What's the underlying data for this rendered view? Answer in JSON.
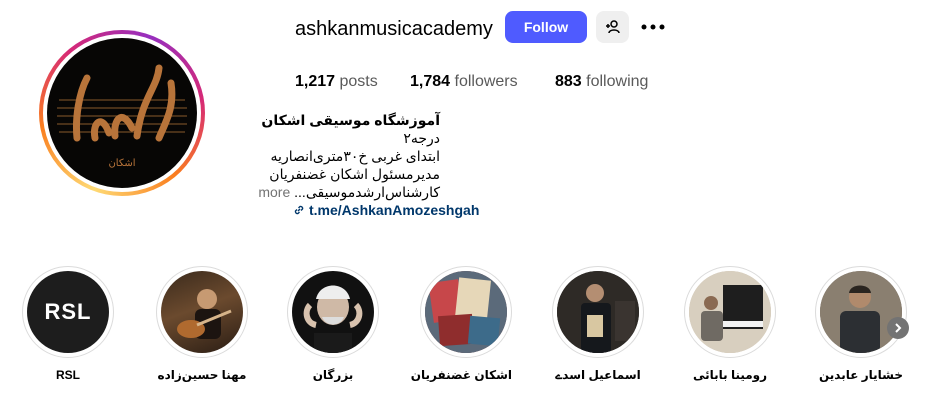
{
  "profile": {
    "username": "ashkanmusicacademy",
    "follow_label": "Follow",
    "logo_text": "اشکان",
    "stats": {
      "posts_count": "1,217",
      "posts_label": "posts",
      "followers_count": "1,784",
      "followers_label": "followers",
      "following_count": "883",
      "following_label": "following"
    },
    "bio": {
      "name": "آموزشگاه موسیقی اشکان",
      "line1": "درجه۲",
      "line2": "ابتدای غربی خ۳۰متری‌انصاریه",
      "line3": "مدیرمسئول اشکان غضنفریان",
      "line4": "کارشناس‌ارشدموسیقی...",
      "more_label": "more"
    },
    "link_text": "t.me/AshkanAmozeshgah"
  },
  "highlights": [
    {
      "label": "RSL",
      "thumb": "rsl-logo"
    },
    {
      "label": "مهنا حسین‌زاده",
      "thumb": "guitarist"
    },
    {
      "label": "بزرگان",
      "thumb": "elder-portrait"
    },
    {
      "label": "اشکان غضنفریان",
      "thumb": "books"
    },
    {
      "label": "اسماعیل اسدے",
      "thumb": "man-with-book"
    },
    {
      "label": "رومینا بابائی",
      "thumb": "piano"
    },
    {
      "label": "خشایار عابدین",
      "thumb": "man-portrait"
    }
  ],
  "colors": {
    "follow_bg": "#4f5bff",
    "link": "#00376b",
    "secondary_text": "#737373"
  }
}
